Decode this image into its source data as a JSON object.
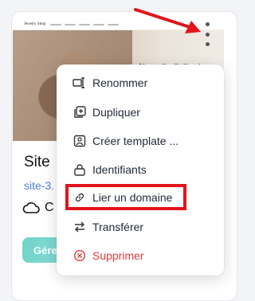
{
  "card": {
    "title": "Site",
    "url": "site-3.",
    "status_letter": "C",
    "manage_label": "Gére"
  },
  "thumbnail": {
    "logo": "Jewelry Shop",
    "caption": "Nouvelle Collection"
  },
  "menu": {
    "items": [
      {
        "label": "Renommer",
        "icon": "rename-icon"
      },
      {
        "label": "Dupliquer",
        "icon": "duplicate-icon"
      },
      {
        "label": "Créer template ...",
        "icon": "template-icon"
      },
      {
        "label": "Identifiants",
        "icon": "lock-icon"
      },
      {
        "label": "Lier un domaine",
        "icon": "link-icon"
      },
      {
        "label": "Transférer",
        "icon": "transfer-icon"
      },
      {
        "label": "Supprimer",
        "icon": "delete-icon"
      }
    ]
  },
  "colors": {
    "danger": "#e23a3a",
    "highlight_border": "#e2141b",
    "link": "#4f7fd6",
    "accent_gradient_start": "#6fd6c6"
  }
}
